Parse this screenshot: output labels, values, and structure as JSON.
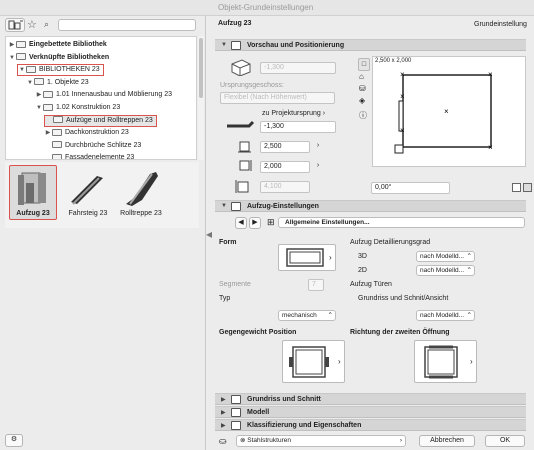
{
  "window": {
    "title": "Objekt-Grundeinstellungen"
  },
  "library": {
    "search_placeholder": "",
    "tree": [
      {
        "label": "Eingebettete Bibliothek",
        "level": 0,
        "caret": "▶",
        "bold": true
      },
      {
        "label": "Verknüpfte Bibliotheken",
        "level": 0,
        "caret": "▼",
        "bold": true
      },
      {
        "label": "BIBLIOTHEKEN 23",
        "level": 1,
        "caret": "▼",
        "bold": false
      },
      {
        "label": "1. Objekte 23",
        "level": 2,
        "caret": "▼",
        "bold": false
      },
      {
        "label": "1.01 Innenausbau und Möblierung 23",
        "level": 3,
        "caret": "▶",
        "bold": false
      },
      {
        "label": "1.02 Konstruktion 23",
        "level": 3,
        "caret": "▼",
        "bold": false
      },
      {
        "label": "Aufzüge und Rolltreppen 23",
        "level": 4,
        "caret": "",
        "bold": false
      },
      {
        "label": "Dachkonstruktion 23",
        "level": 4,
        "caret": "▶",
        "bold": false
      },
      {
        "label": "Durchbrüche Schlitze 23",
        "level": 4,
        "caret": "",
        "bold": false
      },
      {
        "label": "Fassadenelemente 23",
        "level": 4,
        "caret": "",
        "bold": false
      }
    ],
    "items": [
      {
        "label": "Aufzug 23",
        "selected": true
      },
      {
        "label": "Fahrsteig 23",
        "selected": false
      },
      {
        "label": "Rolltreppe 23",
        "selected": false
      }
    ]
  },
  "object": {
    "name": "Aufzug 23",
    "preset": "Grundeinstellung"
  },
  "preview": {
    "section_title": "Vorschau und Positionierung",
    "elevation_value": "-1,300",
    "home_story_label": "Ursprungsgeschoss:",
    "home_story_value": "Flexibel (Nach Höhenwert)",
    "reference_label": "zu Projektursprung",
    "reference_value": "-1,300",
    "width_value": "2,500",
    "depth_value": "2,000",
    "height_value": "4,100",
    "size_label": "2,500 x 2,000",
    "angle_value": "0,00°"
  },
  "settings": {
    "section_title": "Aufzug-Einstellungen",
    "page_label": "Allgemeine Einstellungen...",
    "form_label": "Form",
    "detail_label": "Aufzug Detaillierungsgrad",
    "d3_label": "3D",
    "d3_value": "nach Modelld...",
    "d2_label": "2D",
    "d2_value": "nach Modelld...",
    "doors_label": "Aufzug Türen",
    "segments_label": "Segmente",
    "segments_value": "7",
    "type_label": "Typ",
    "type_value": "mechanisch",
    "plan_label": "Grundriss und Schnit/Ansicht",
    "plan_value": "nach Modelld...",
    "counterweight_label": "Gegengewicht Position",
    "second_opening_label": "Richtung der zweiten Öffnung"
  },
  "collapsed_sections": [
    "Grundriss und Schnitt",
    "Modell",
    "Klassifizierung und Eigenschaften"
  ],
  "footer": {
    "structure_label": "Stahlstrukturen",
    "cancel_label": "Abbrechen",
    "ok_label": "OK"
  }
}
